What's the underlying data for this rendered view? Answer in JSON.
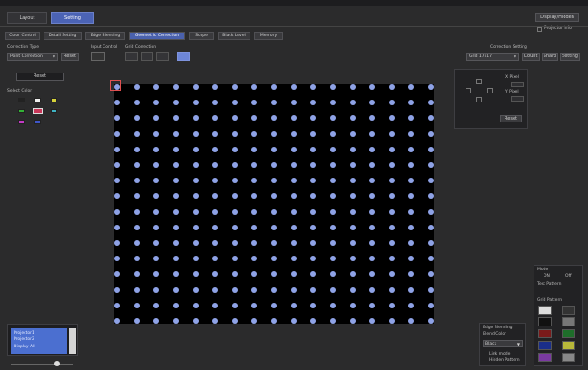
{
  "top_tabs": [
    "Layout",
    "Setting"
  ],
  "top_right_button": "Display/Hidden",
  "top_right_check_label": "Projector info",
  "sub_tabs": [
    "Color Control",
    "Detail Setting",
    "Edge Blending",
    "Geometric Correction",
    "Scope",
    "Black Level",
    "Memory"
  ],
  "correction_type": {
    "label": "Correction Type",
    "value": "Point Correction",
    "reset_label": "Reset"
  },
  "input_control": {
    "label": "Input Control"
  },
  "grid_correction": {
    "label": "Grid Correction"
  },
  "correction_setting": {
    "label": "Correction Setting",
    "value": "Grid 17x17",
    "buttons": [
      "Count",
      "Sharp",
      "Setting"
    ]
  },
  "left_panel": {
    "button": "Reset",
    "color_label": "Select Color"
  },
  "move_panel": {
    "x_label": "X Pixel",
    "y_label": "Y Pixel",
    "button": "Reset"
  },
  "bottom_left_list": [
    "Projector1",
    "Projector2"
  ],
  "bottom_left_check": "Display All",
  "right_panel": {
    "title": "Mode",
    "on": "ON",
    "off": "Off",
    "pattern_label": "Test Pattern",
    "grid_label": "Grid Pattern"
  },
  "bottom_right": {
    "title": "Edge Blending",
    "sub_label": "Blend Color",
    "value": "Black",
    "check": "Link mode",
    "check2": "Hidden Pattern"
  },
  "colors": {
    "accent": "#4b63b5",
    "grid_dot": "#8ea2e6",
    "bg": "#2b2b2c"
  },
  "grid": {
    "cols": 17,
    "rows": 16
  }
}
